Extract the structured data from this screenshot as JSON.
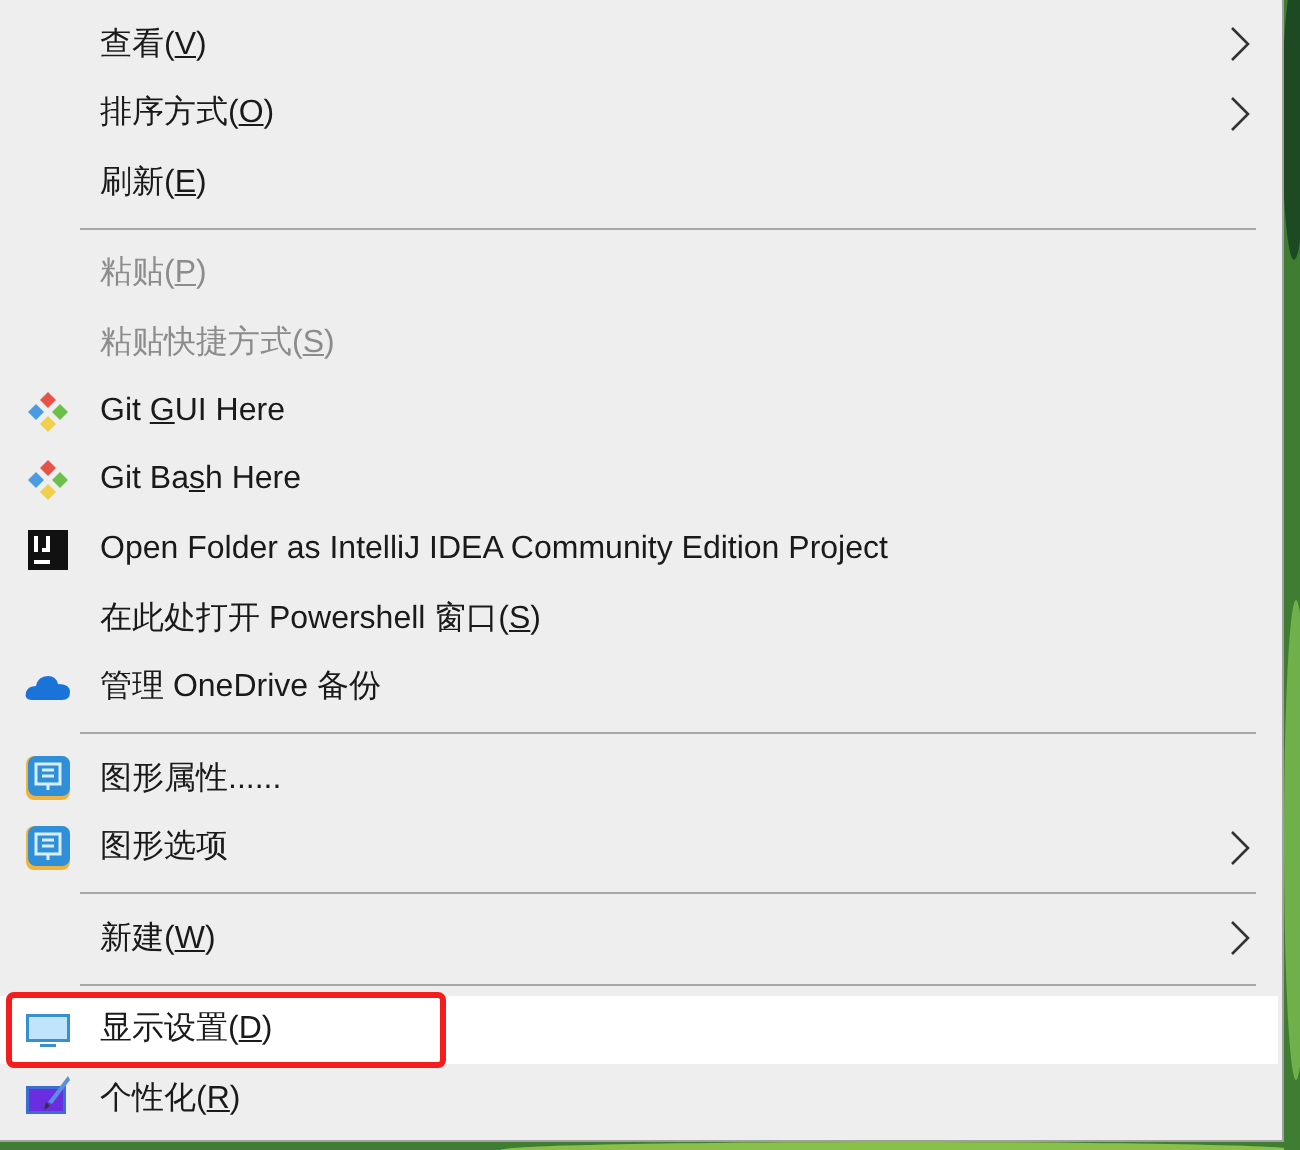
{
  "menu": {
    "items": [
      {
        "kind": "item",
        "label": "查看(",
        "key": "V",
        "after": ")",
        "submenu": true,
        "disabled": false,
        "selected": false
      },
      {
        "kind": "item",
        "label": "排序方式(",
        "key": "O",
        "after": ")",
        "submenu": true,
        "disabled": false,
        "selected": false
      },
      {
        "kind": "item",
        "label": "刷新(",
        "key": "E",
        "after": ")",
        "submenu": false,
        "disabled": false,
        "selected": false
      },
      {
        "kind": "separator"
      },
      {
        "kind": "item",
        "label": "粘贴(",
        "key": "P",
        "after": ")",
        "submenu": false,
        "disabled": true,
        "selected": false
      },
      {
        "kind": "item",
        "label": "粘贴快捷方式(",
        "key": "S",
        "after": ")",
        "submenu": false,
        "disabled": true,
        "selected": false
      },
      {
        "kind": "item",
        "label": "Git ",
        "key": "G",
        "after": "UI Here",
        "submenu": false,
        "disabled": false,
        "selected": false
      },
      {
        "kind": "item",
        "label": "Git Ba",
        "key": "s",
        "after": "h Here",
        "submenu": false,
        "disabled": false,
        "selected": false
      },
      {
        "kind": "item",
        "label": "Open Folder as IntelliJ IDEA Community Edition Project",
        "submenu": false,
        "disabled": false,
        "selected": false
      },
      {
        "kind": "item",
        "label": "在此处打开 Powershell 窗口(",
        "key": "S",
        "after": ")",
        "submenu": false,
        "disabled": false,
        "selected": false
      },
      {
        "kind": "item",
        "label": "管理 OneDrive 备份",
        "submenu": false,
        "disabled": false,
        "selected": false
      },
      {
        "kind": "separator"
      },
      {
        "kind": "item",
        "label": "图形属性......",
        "submenu": false,
        "disabled": false,
        "selected": false
      },
      {
        "kind": "item",
        "label": "图形选项",
        "submenu": true,
        "disabled": false,
        "selected": false
      },
      {
        "kind": "separator"
      },
      {
        "kind": "item",
        "label": "新建(",
        "key": "W",
        "after": ")",
        "submenu": true,
        "disabled": false,
        "selected": false
      },
      {
        "kind": "separator"
      },
      {
        "kind": "item",
        "label": "显示设置(",
        "key": "D",
        "after": ")",
        "submenu": false,
        "disabled": false,
        "selected": true,
        "annotated": true
      },
      {
        "kind": "item",
        "label": "个性化(",
        "key": "R",
        "after": ")",
        "submenu": false,
        "disabled": false,
        "selected": false
      }
    ]
  }
}
